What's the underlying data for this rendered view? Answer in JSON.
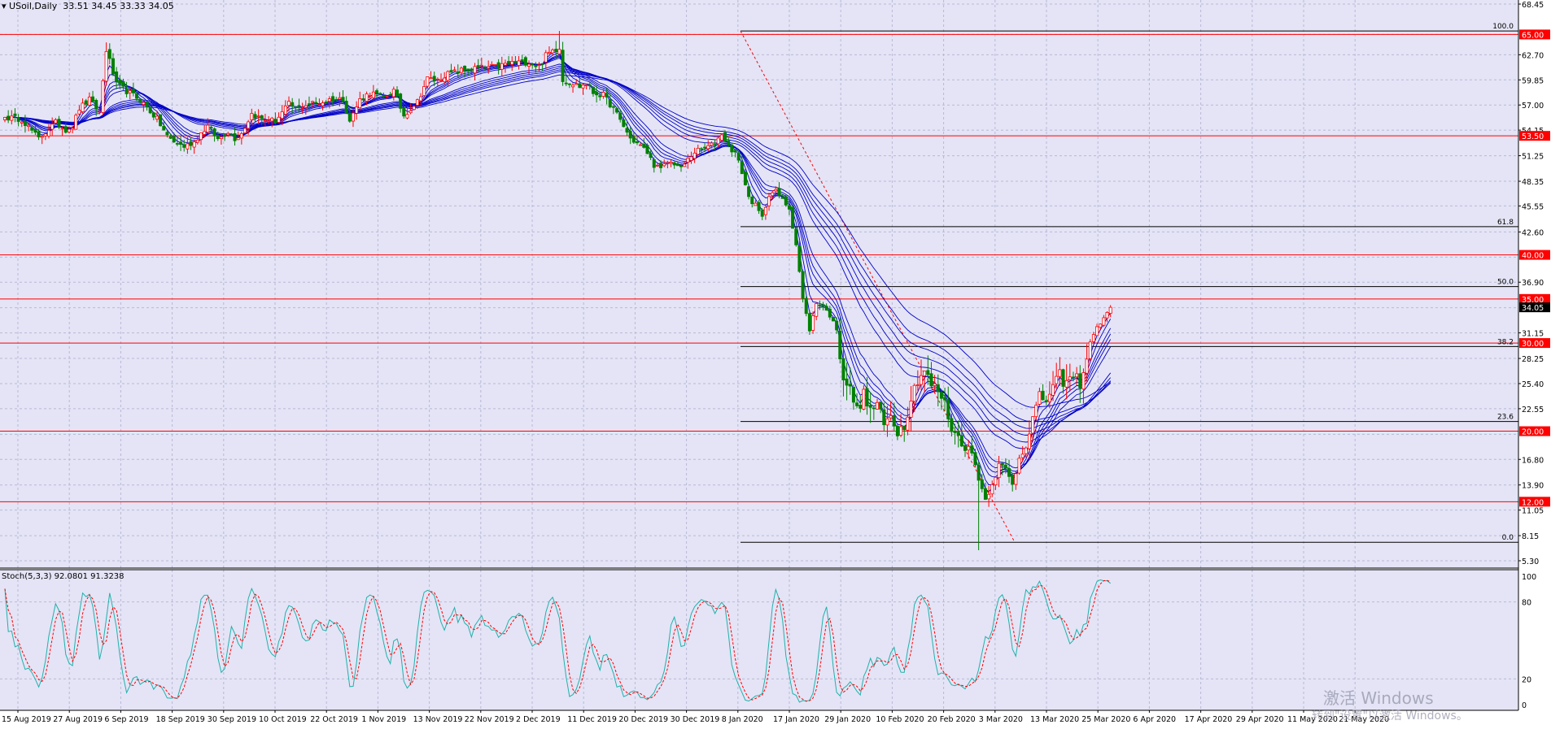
{
  "window": {
    "symbol_title": "USoil,Daily",
    "ohlc_text": "33.51 34.45 33.33 34.05",
    "stoch_title": "Stoch(5,3,3) 92.0801 91.3238"
  },
  "watermark": {
    "line1": "激活 Windows",
    "line2": "转到\"设置\"以激活 Windows。"
  },
  "colors": {
    "background": "#e4e4f6",
    "grid": "#b8b8d6",
    "bull_candle": "#ff0000",
    "bear_candle": "#008000",
    "ribbon": "#0000c8",
    "level_line": "#ff0000",
    "fib_line": "#000000",
    "stoch_main": "#20b2aa",
    "stoch_signal": "#ff0000"
  },
  "price_axis": {
    "labels": [
      "68.45",
      "65.00",
      "62.70",
      "59.85",
      "57.00",
      "54.15",
      "53.50",
      "51.25",
      "48.35",
      "45.55",
      "42.60",
      "40.00",
      "36.90",
      "35.00",
      "34.05",
      "31.15",
      "30.00",
      "28.25",
      "25.40",
      "22.55",
      "20.00",
      "16.80",
      "13.90",
      "12.00",
      "11.05",
      "8.15",
      "5.30"
    ]
  },
  "stoch_axis": {
    "labels": [
      "100",
      "80",
      "20",
      "0"
    ]
  },
  "time_axis": {
    "labels": [
      "15 Aug 2019",
      "27 Aug 2019",
      "6 Sep 2019",
      "18 Sep 2019",
      "30 Sep 2019",
      "10 Oct 2019",
      "22 Oct 2019",
      "1 Nov 2019",
      "13 Nov 2019",
      "22 Nov 2019",
      "2 Dec 2019",
      "11 Dec 2019",
      "20 Dec 2019",
      "30 Dec 2019",
      "8 Jan 2020",
      "17 Jan 2020",
      "29 Jan 2020",
      "10 Feb 2020",
      "20 Feb 2020",
      "3 Mar 2020",
      "13 Mar 2020",
      "25 Mar 2020",
      "6 Apr 2020",
      "17 Apr 2020",
      "29 Apr 2020",
      "11 May 2020",
      "21 May 2020"
    ]
  },
  "chart_data": {
    "type": "candlestick",
    "symbol": "USoil",
    "timeframe": "Daily",
    "price_range": [
      5.3,
      68.45
    ],
    "horizontal_levels": [
      {
        "price": 65.0,
        "label": "65.00"
      },
      {
        "price": 53.5,
        "label": "53.50"
      },
      {
        "price": 40.0,
        "label": "40.00"
      },
      {
        "price": 35.0,
        "label": "35.00"
      },
      {
        "price": 30.0,
        "label": "30.00"
      },
      {
        "price": 20.0,
        "label": "20.00"
      },
      {
        "price": 12.0,
        "label": "12.00"
      }
    ],
    "current_price": {
      "price": 34.05,
      "label": "34.05"
    },
    "fibonacci": {
      "high": 65.4,
      "low": 7.4,
      "levels": [
        {
          "ratio": "100.0",
          "price": 65.4
        },
        {
          "ratio": "61.8",
          "price": 43.2
        },
        {
          "ratio": "50.0",
          "price": 36.4
        },
        {
          "ratio": "38.2",
          "price": 29.6
        },
        {
          "ratio": "23.6",
          "price": 21.1
        },
        {
          "ratio": "0.0",
          "price": 7.4
        }
      ]
    },
    "trend_line": {
      "from": {
        "date": "8 Jan 2020",
        "price": 65.4
      },
      "to": {
        "date": "3 Mar 2020",
        "price": 7.4
      }
    },
    "close_keypoints": [
      [
        0,
        55.6
      ],
      [
        5,
        55.4
      ],
      [
        10,
        53.2
      ],
      [
        15,
        55.0
      ],
      [
        18,
        54.2
      ],
      [
        20,
        54.6
      ],
      [
        22,
        56.6
      ],
      [
        25,
        57.6
      ],
      [
        28,
        56.2
      ],
      [
        30,
        63.3
      ],
      [
        33,
        59.3
      ],
      [
        38,
        58.1
      ],
      [
        40,
        57.6
      ],
      [
        45,
        55.4
      ],
      [
        48,
        53.5
      ],
      [
        50,
        52.8
      ],
      [
        53,
        52.3
      ],
      [
        56,
        52.8
      ],
      [
        58,
        53.8
      ],
      [
        60,
        54.6
      ],
      [
        63,
        53.1
      ],
      [
        66,
        54.0
      ],
      [
        68,
        53.2
      ],
      [
        70,
        53.8
      ],
      [
        73,
        56.0
      ],
      [
        76,
        55.4
      ],
      [
        80,
        55.2
      ],
      [
        84,
        57.1
      ],
      [
        86,
        56.6
      ],
      [
        90,
        57.2
      ],
      [
        93,
        57.2
      ],
      [
        96,
        57.6
      ],
      [
        100,
        57.7
      ],
      [
        102,
        55.2
      ],
      [
        105,
        57.6
      ],
      [
        108,
        58.4
      ],
      [
        112,
        57.9
      ],
      [
        115,
        58.6
      ],
      [
        118,
        55.8
      ],
      [
        120,
        56.6
      ],
      [
        122,
        57.4
      ],
      [
        125,
        60.0
      ],
      [
        128,
        59.8
      ],
      [
        130,
        60.4
      ],
      [
        135,
        60.9
      ],
      [
        140,
        61.2
      ],
      [
        145,
        61.3
      ],
      [
        150,
        61.8
      ],
      [
        155,
        61.9
      ],
      [
        158,
        61.4
      ],
      [
        160,
        62.6
      ],
      [
        162,
        63.2
      ],
      [
        164,
        63.6
      ],
      [
        165,
        59.8
      ],
      [
        167,
        59.6
      ],
      [
        170,
        59.1
      ],
      [
        172,
        59.4
      ],
      [
        174,
        58.4
      ],
      [
        177,
        58.1
      ],
      [
        180,
        56.6
      ],
      [
        183,
        54.6
      ],
      [
        185,
        53.2
      ],
      [
        188,
        52.4
      ],
      [
        190,
        51.6
      ],
      [
        192,
        50.2
      ],
      [
        194,
        49.7
      ],
      [
        196,
        50.5
      ],
      [
        198,
        50.4
      ],
      [
        200,
        49.8
      ],
      [
        202,
        50.8
      ],
      [
        204,
        51.7
      ],
      [
        207,
        52.1
      ],
      [
        210,
        52.6
      ],
      [
        212,
        53.8
      ],
      [
        214,
        52.3
      ],
      [
        216,
        51.6
      ],
      [
        218,
        49.4
      ],
      [
        220,
        46.5
      ],
      [
        222,
        45.6
      ],
      [
        224,
        44.2
      ],
      [
        226,
        46.9
      ],
      [
        228,
        47.2
      ],
      [
        230,
        46.2
      ],
      [
        232,
        45.3
      ],
      [
        234,
        41.2
      ],
      [
        236,
        35.0
      ],
      [
        238,
        31.5
      ],
      [
        240,
        34.5
      ],
      [
        242,
        34.2
      ],
      [
        244,
        33.1
      ],
      [
        246,
        31.6
      ],
      [
        248,
        26.2
      ],
      [
        250,
        24.6
      ],
      [
        252,
        22.4
      ],
      [
        254,
        24.1
      ],
      [
        256,
        22.3
      ],
      [
        258,
        23.2
      ],
      [
        260,
        20.6
      ],
      [
        262,
        21.9
      ],
      [
        264,
        20.0
      ],
      [
        266,
        20.7
      ],
      [
        268,
        23.8
      ],
      [
        270,
        26.0
      ],
      [
        272,
        26.9
      ],
      [
        274,
        25.2
      ],
      [
        276,
        24.6
      ],
      [
        278,
        23.1
      ],
      [
        280,
        20.3
      ],
      [
        282,
        19.3
      ],
      [
        284,
        18.3
      ],
      [
        286,
        17.5
      ],
      [
        288,
        14.8
      ],
      [
        290,
        12.2
      ],
      [
        292,
        14.2
      ],
      [
        294,
        16.1
      ],
      [
        296,
        15.6
      ],
      [
        298,
        13.9
      ],
      [
        300,
        17.0
      ],
      [
        302,
        18.6
      ],
      [
        304,
        21.4
      ],
      [
        306,
        23.8
      ],
      [
        308,
        23.6
      ],
      [
        310,
        24.9
      ],
      [
        312,
        26.2
      ],
      [
        314,
        25.4
      ],
      [
        316,
        26.2
      ],
      [
        318,
        25.6
      ],
      [
        320,
        28.2
      ],
      [
        322,
        31.1
      ],
      [
        324,
        32.3
      ],
      [
        326,
        33.3
      ],
      [
        327,
        34.05
      ]
    ],
    "stochastic": {
      "name": "Stoch(5,3,3)",
      "main_value": 92.0801,
      "signal_value": 91.3238,
      "range": [
        0,
        100
      ],
      "levels": [
        20,
        80
      ]
    }
  }
}
